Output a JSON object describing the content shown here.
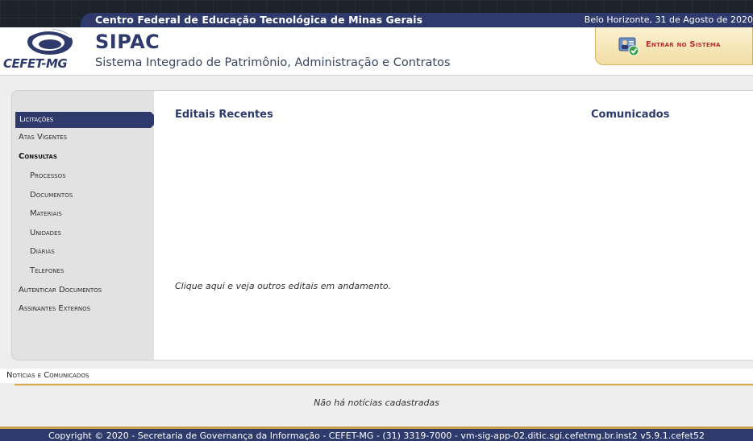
{
  "header": {
    "institution": "Centro Federal de Educação Tecnológica de Minas Gerais",
    "date": "Belo Horizonte, 31 de Agosto de 2020",
    "logo_text": "CEFET-MG",
    "system_acronym": "SIPAC",
    "system_name": "Sistema Integrado de Patrimônio, Administração e Contratos",
    "login_label": "Entrar no Sistema"
  },
  "menu": {
    "items": [
      {
        "label": "Licitações",
        "active": true
      },
      {
        "label": "Atas Vigentes"
      },
      {
        "label": "Consultas",
        "bold": true
      },
      {
        "label": "Processos",
        "sub": true
      },
      {
        "label": "Documentos",
        "sub": true
      },
      {
        "label": "Materiais",
        "sub": true
      },
      {
        "label": "Unidades",
        "sub": true
      },
      {
        "label": "Diárias",
        "sub": true
      },
      {
        "label": "Telefones",
        "sub": true
      },
      {
        "label": "Autenticar Documentos"
      },
      {
        "label": "Assinantes Externos"
      }
    ]
  },
  "content": {
    "editais_title": "Editais Recentes",
    "comunicados_title": "Comunicados",
    "editais_link": "Clique aqui e veja outros editais em andamento."
  },
  "news": {
    "title": "Notícias e Comunicados",
    "empty": "Não há notícias cadastradas"
  },
  "footer": {
    "text": "Copyright © 2020 - Secretaria de Governança da Informação - CEFET-MG - (31) 3319-7000 - vm-sig-app-02.ditic.sgi.cefetmg.br.inst2 v5.9.1.cefet52"
  },
  "colors": {
    "brand": "#2d3a6b",
    "accent": "#c9a049",
    "login_text": "#b8312f"
  }
}
